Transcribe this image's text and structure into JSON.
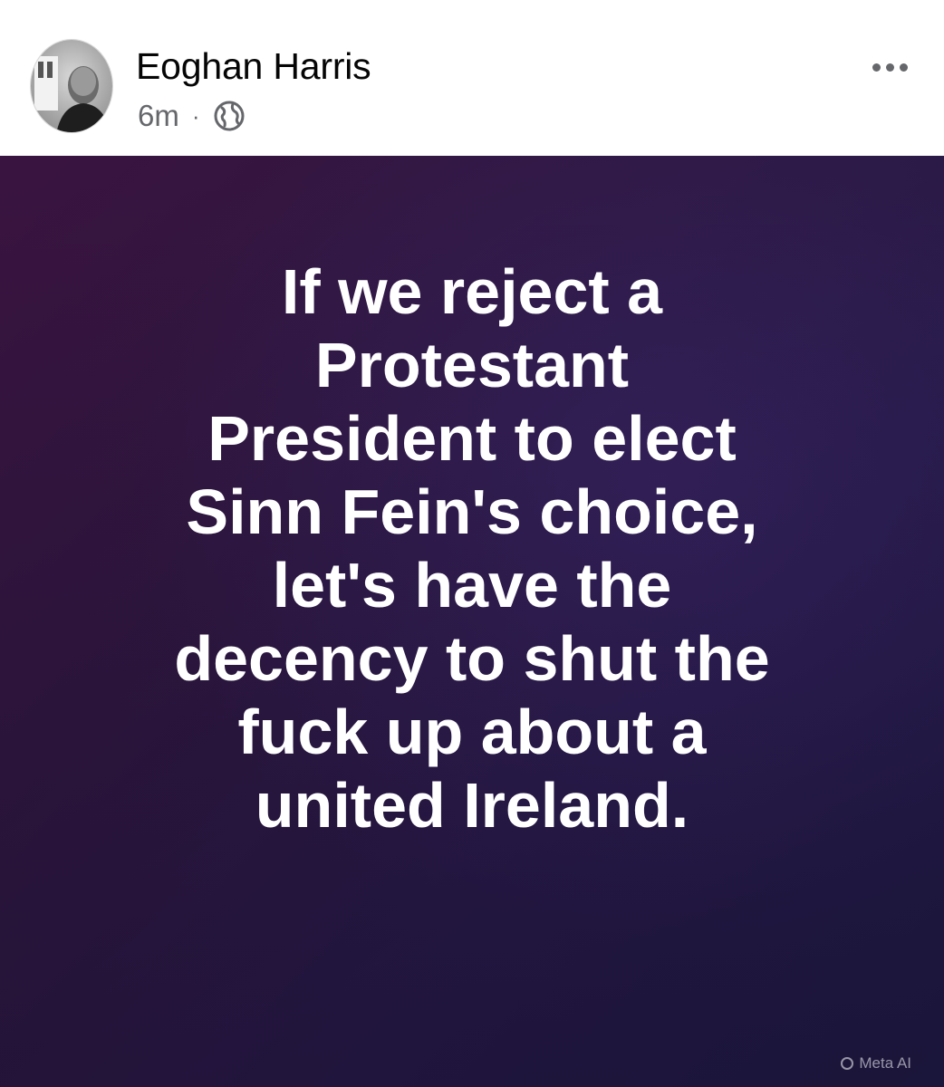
{
  "post": {
    "author": {
      "name": "Eoghan Harris",
      "avatar_icon": "profile-photo"
    },
    "timestamp": "6m",
    "separator": "·",
    "audience_icon": "globe-icon",
    "more_icon": "more-options-icon"
  },
  "image": {
    "lines": [
      "If we reject a",
      "Protestant",
      "President to elect",
      "Sinn Fein's choice,",
      "let's have the",
      "decency to shut the",
      "fuck up about a",
      "united Ireland."
    ],
    "background_colors": [
      "#3a1440",
      "#1c1a45"
    ],
    "watermark": "Meta AI"
  }
}
